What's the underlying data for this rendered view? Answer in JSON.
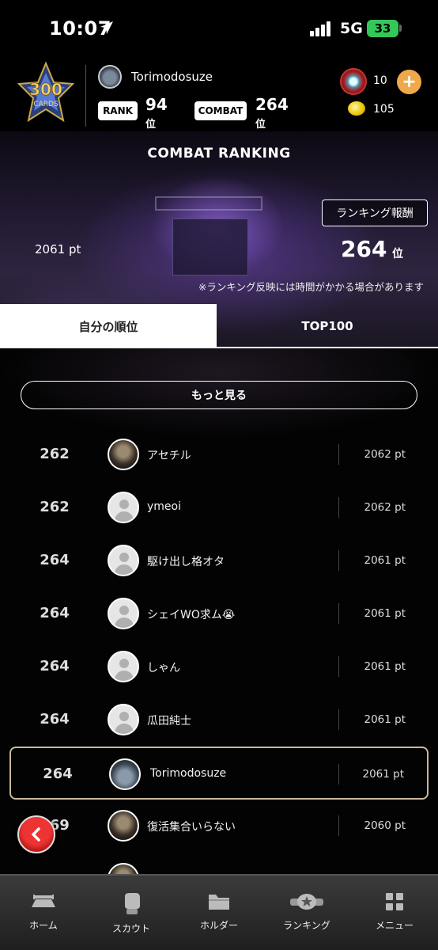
{
  "status_bar": {
    "time": "10:07",
    "network": "5G",
    "battery": "33"
  },
  "header": {
    "badge_number": "300",
    "badge_text": "CARDS",
    "username": "Torimodosuze",
    "rank_label": "RANK",
    "rank_value": "94",
    "rank_unit": "位",
    "combat_label": "COMBAT",
    "combat_value": "264",
    "combat_unit": "位",
    "gem_count": "10",
    "coin_count": "105",
    "plus_label": "+"
  },
  "hero": {
    "title": "COMBAT RANKING",
    "reward_button": "ランキング報酬",
    "my_points": "2061 pt",
    "my_rank": "264",
    "my_rank_unit": "位",
    "note": "※ランキング反映には時間がかかる場合があります"
  },
  "tabs": {
    "mine": "自分の順位",
    "top100": "TOP100"
  },
  "list": {
    "more_button": "もっと見る",
    "rows": [
      {
        "rank": "262",
        "name": "アセチル",
        "points": "2062 pt"
      },
      {
        "rank": "262",
        "name": "ymeoi",
        "points": "2062 pt"
      },
      {
        "rank": "264",
        "name": "駆け出し格オタ",
        "points": "2061 pt"
      },
      {
        "rank": "264",
        "name": "シェイWO求ム😭",
        "points": "2061 pt"
      },
      {
        "rank": "264",
        "name": "しゃん",
        "points": "2061 pt"
      },
      {
        "rank": "264",
        "name": "瓜田純士",
        "points": "2061 pt"
      },
      {
        "rank": "264",
        "name": "Torimodosuze",
        "points": "2061 pt"
      },
      {
        "rank": "269",
        "name": "復活集合いらない",
        "points": "2060 pt"
      }
    ]
  },
  "bottom_nav": [
    {
      "label": "ホーム",
      "icon": "ring-icon"
    },
    {
      "label": "スカウト",
      "icon": "glove-icon"
    },
    {
      "label": "ホルダー",
      "icon": "folder-icon"
    },
    {
      "label": "ランキング",
      "icon": "belt-icon"
    },
    {
      "label": "メニュー",
      "icon": "grid-icon"
    }
  ],
  "colors": {
    "accent_orange": "#f0a94a",
    "battery_green": "#34c759",
    "highlight_border": "#c9b89a",
    "back_red": "#cc2222"
  }
}
